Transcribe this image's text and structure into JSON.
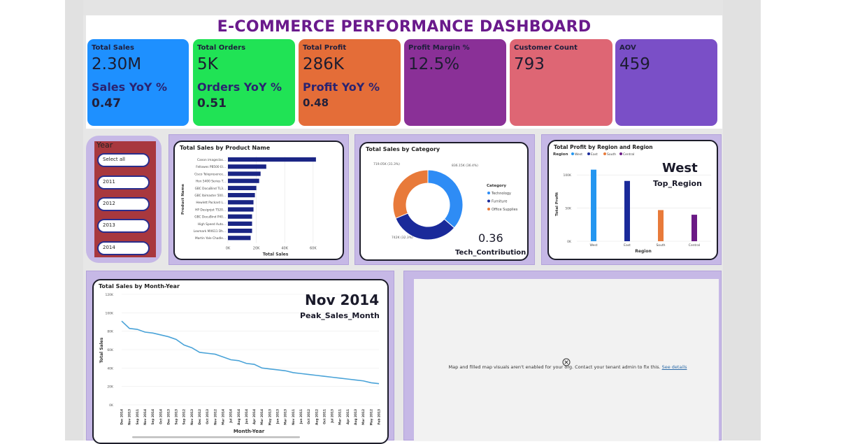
{
  "title": "E-COMMERCE PERFORMANCE DASHBOARD",
  "kpis": [
    {
      "label": "Total Sales",
      "value": "2.30M",
      "sub_label": "Sales YoY %",
      "sub_value": "0.47",
      "color": "#1e90ff"
    },
    {
      "label": "Total Orders",
      "value": "5K",
      "sub_label": "Orders YoY %",
      "sub_value": "0.51",
      "color": "#20e355"
    },
    {
      "label": "Total Profit",
      "value": "286K",
      "sub_label": "Profit YoY %",
      "sub_value": "0.48",
      "color": "#e46d38"
    },
    {
      "label": "Profit Margin %",
      "value": "12.5%",
      "color": "#8a3097"
    },
    {
      "label": "Customer Count",
      "value": "793",
      "color": "#de6674"
    },
    {
      "label": "AOV",
      "value": "459",
      "color": "#7a4fc7"
    }
  ],
  "slicer": {
    "title": "Year",
    "items": [
      "Select all",
      "2011",
      "2012",
      "2013",
      "2014"
    ]
  },
  "product_card": {
    "title": "Total Sales by Product Name"
  },
  "category_card": {
    "title": "Total Sales by Category",
    "kpi_value": "0.36",
    "kpi_label": "Tech_Contribution"
  },
  "region_card": {
    "title": "Total Profit by Region and Region",
    "legend_title": "Region",
    "kpi_value": "West",
    "kpi_label": "Top_Region"
  },
  "month_card": {
    "title": "Total Sales by Month-Year",
    "kpi_value": "Nov 2014",
    "kpi_label": "Peak_Sales_Month"
  },
  "map_card": {
    "icon": "close-circle-icon",
    "message": "Map and filled map visuals aren't enabled for your org. Contact your tenant admin to fix this.",
    "link": "See details"
  },
  "chart_data": [
    {
      "type": "bar",
      "orientation": "horizontal",
      "title": "Total Sales by Product Name",
      "xlabel": "Total Sales",
      "ylabel": "Product Name",
      "categories": [
        "Canon imageclas...",
        "Fellowes PB500 El...",
        "Cisco Telepresence...",
        "Hon 5400 Series T...",
        "GBC DocuBind TL3...",
        "GBC Ibimaster 500...",
        "Hewlett Packard L...",
        "HP Designjet T520...",
        "GBC DocuBind P40...",
        "High Speed Auto...",
        "Lexmark MX611 Dh...",
        "Martin Yale Chadle..."
      ],
      "values": [
        62,
        27,
        23,
        22,
        20,
        19,
        18,
        18,
        17,
        17,
        17,
        16
      ],
      "xticks": [
        "0K",
        "20K",
        "40K",
        "60K"
      ],
      "xlim": [
        0,
        66
      ],
      "color": "#1a2585",
      "grid": true
    },
    {
      "type": "pie",
      "donut": true,
      "title": "Total Sales by Category",
      "legend_title": "Category",
      "legend_position": "right",
      "series": [
        {
          "name": "Technology",
          "value": 836.15,
          "label": "836.15K (36.4%)",
          "color": "#2e8cf5"
        },
        {
          "name": "Furniture",
          "value": 742,
          "label": "742K (32.3%)",
          "color": "#1a2a9a"
        },
        {
          "name": "Office Supplies",
          "value": 719.05,
          "label": "719.05K (31.3%)",
          "color": "#e87a3a"
        }
      ]
    },
    {
      "type": "bar",
      "title": "Total Profit by Region and Region",
      "xlabel": "Region",
      "ylabel": "Total Profit",
      "legend_title": "Region",
      "legend_position": "top-left",
      "categories": [
        "West",
        "East",
        "South",
        "Central"
      ],
      "values": [
        108,
        91,
        47,
        40
      ],
      "colors": [
        "#2496f0",
        "#1a2a9a",
        "#e87a3a",
        "#6b1a85"
      ],
      "yticks": [
        "0K",
        "50K",
        "100K"
      ],
      "ylim": [
        0,
        115
      ],
      "grid": true
    },
    {
      "type": "line",
      "title": "Total Sales by Month-Year",
      "xlabel": "Month-Year",
      "ylabel": "Total Sales",
      "x": [
        "Dec 2014",
        "Nov 2013",
        "Sep 2011",
        "Nov 2014",
        "Sep 2014",
        "Oct 2014",
        "Dec 2013",
        "Sep 2013",
        "Sep 2012",
        "Nov 2013",
        "Dec 2012",
        "Oct 2013",
        "Nov 2012",
        "Mar 2014",
        "Jul 2014",
        "Aug 2014",
        "Jun 2014",
        "Apr 2014",
        "Mar 2014",
        "May 2013",
        "Jun 2013",
        "Mar 2013",
        "Nov 2011",
        "Jun 2011",
        "Oct 2012",
        "Aug 2012",
        "Oct 2011",
        "Jul 2013",
        "Mar 2011",
        "Apr 2011",
        "Aug 2013",
        "Mar 2012",
        "May 2012",
        "Feb 2013"
      ],
      "values": [
        91,
        83,
        82,
        79,
        78,
        76,
        74,
        71,
        65,
        62,
        57,
        56,
        55,
        52,
        49,
        48,
        45,
        44,
        40,
        39,
        38,
        37,
        35,
        34,
        33,
        32,
        31,
        30,
        29,
        28,
        27,
        26,
        24,
        23
      ],
      "yticks": [
        "0K",
        "20K",
        "40K",
        "60K",
        "80K",
        "100K",
        "120K"
      ],
      "ylim": [
        0,
        120
      ],
      "color": "#4aa3d8",
      "grid": true
    }
  ]
}
